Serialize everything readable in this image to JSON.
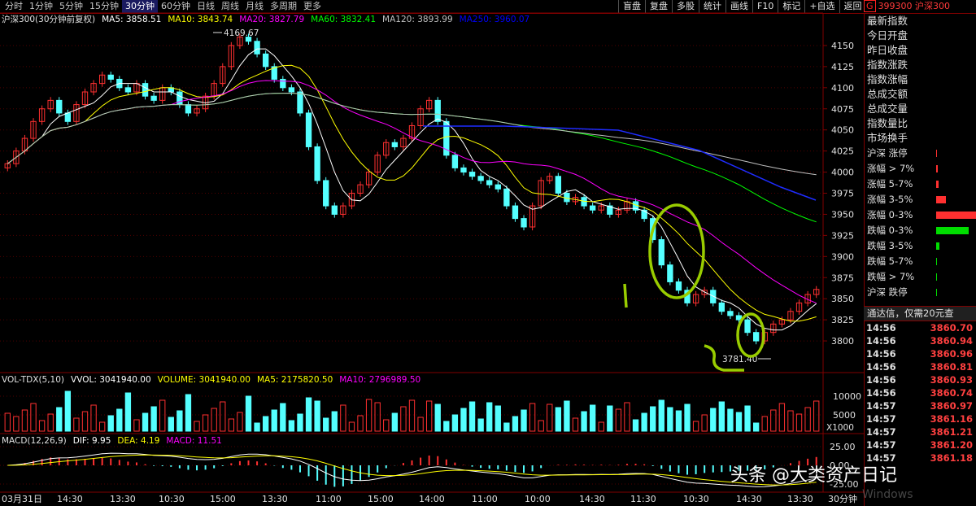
{
  "toolbar": {
    "periods": [
      "分时",
      "1分钟",
      "5分钟",
      "15分钟",
      "30分钟",
      "60分钟",
      "日线",
      "周线",
      "月线",
      "多周期",
      "更多"
    ],
    "active_period": "30分钟",
    "right_tools": [
      "盲盘",
      "复盘",
      "多股",
      "统计",
      "画线",
      "F10",
      "标记",
      "+自选",
      "返回"
    ],
    "code_badge": "G",
    "code": "399300",
    "name": "沪深300"
  },
  "main_header": {
    "title": "沪深300(30分钟前复权)",
    "ma": [
      {
        "label": "MA5: 3858.51",
        "color": "#ffffff"
      },
      {
        "label": "MA10: 3843.74",
        "color": "#ffff00"
      },
      {
        "label": "MA20: 3827.79",
        "color": "#ff00ff"
      },
      {
        "label": "MA60: 3832.41",
        "color": "#00ff00"
      },
      {
        "label": "MA120: 3893.99",
        "color": "#c0c0c0"
      },
      {
        "label": "MA250: 3960.07",
        "color": "#0000ff"
      }
    ]
  },
  "price_axis": [
    "4150",
    "4125",
    "4100",
    "4075",
    "4050",
    "4025",
    "4000",
    "3975",
    "3950",
    "3925",
    "3900",
    "3875",
    "3850",
    "3825",
    "3800"
  ],
  "price_annotations": {
    "high": "4169.67",
    "low": "3781.40"
  },
  "vol_header": {
    "title": "VOL-TDX(5,10)",
    "items": [
      {
        "label": "VVOL: 3041940.00",
        "color": "#ffffff"
      },
      {
        "label": "VOLUME: 3041940.00",
        "color": "#ffff00"
      },
      {
        "label": "MA5: 2175820.50",
        "color": "#ffff00"
      },
      {
        "label": "MA10: 2796989.50",
        "color": "#ff00ff"
      }
    ]
  },
  "vol_axis": [
    "10000",
    "5000"
  ],
  "vol_unit": "X1000",
  "macd_header": {
    "title": "MACD(12,26,9)",
    "items": [
      {
        "label": "DIF: 9.95",
        "color": "#ffffff"
      },
      {
        "label": "DEA: 4.19",
        "color": "#ffff00"
      },
      {
        "label": "MACD: 11.51",
        "color": "#ff00ff"
      }
    ]
  },
  "macd_axis": [
    "25.00",
    "0.00",
    "-25.00"
  ],
  "time_axis": [
    "03月31日",
    "14:30",
    "13:30",
    "10:30",
    "15:00",
    "13:30",
    "11:00",
    "15:00",
    "14:00",
    "11:00",
    "10:00",
    "14:30",
    "11:30",
    "10:30",
    "14:30",
    "13:30"
  ],
  "time_axis_period": "30分钟",
  "right_panel": {
    "fields": [
      "最新指数",
      "今日开盘",
      "昨日收盘",
      "指数涨跌",
      "指数涨幅",
      "总成交额",
      "总成交量",
      "指数量比",
      "市场换手"
    ],
    "breadth": [
      {
        "label": "沪深 涨停",
        "bar": 0,
        "color": "#ff3030"
      },
      {
        "label": "涨幅 > 7%",
        "bar": 2,
        "color": "#ff3030"
      },
      {
        "label": "涨幅 5-7%",
        "bar": 3,
        "color": "#ff3030"
      },
      {
        "label": "涨幅 3-5%",
        "bar": 12,
        "color": "#ff3030"
      },
      {
        "label": "涨幅 0-3%",
        "bar": 50,
        "color": "#ff3030"
      },
      {
        "label": "跌幅 0-3%",
        "bar": 40,
        "color": "#00dd00"
      },
      {
        "label": "跌幅 3-5%",
        "bar": 4,
        "color": "#00dd00"
      },
      {
        "label": "跌幅 5-7%",
        "bar": 1,
        "color": "#00dd00"
      },
      {
        "label": "跌幅 > 7%",
        "bar": 1,
        "color": "#00dd00"
      },
      {
        "label": "沪深 跌停",
        "bar": 1,
        "color": "#00dd00"
      }
    ],
    "ad_text": "通达信，仅需20元查",
    "ticks": [
      {
        "time": "14:56",
        "price": "3860.70"
      },
      {
        "time": "14:56",
        "price": "3860.94"
      },
      {
        "time": "14:56",
        "price": "3860.96"
      },
      {
        "time": "14:56",
        "price": "3860.81"
      },
      {
        "time": "14:56",
        "price": "3860.93"
      },
      {
        "time": "14:56",
        "price": "3860.74"
      },
      {
        "time": "14:57",
        "price": "3860.97"
      },
      {
        "time": "14:57",
        "price": "3861.16"
      },
      {
        "time": "14:57",
        "price": "3861.21"
      },
      {
        "time": "14:57",
        "price": "3861.20"
      },
      {
        "time": "14:57",
        "price": "3861.18"
      }
    ]
  },
  "watermark": "头条 @大类资产日记",
  "os_watermark": "Windows",
  "colors": {
    "up": "#ff3030",
    "down": "#54ffff",
    "border": "#800000",
    "grid": "#800000",
    "annotation": "#99cc00"
  },
  "chart_data": {
    "type": "candlestick",
    "title": "沪深300(30分钟前复权)",
    "ylim": [
      3775,
      4175
    ],
    "ohlc_close": [
      4010,
      4025,
      4040,
      4060,
      4075,
      4085,
      4070,
      4060,
      4080,
      4095,
      4105,
      4115,
      4110,
      4100,
      4095,
      4105,
      4090,
      4085,
      4100,
      4095,
      4080,
      4070,
      4075,
      4090,
      4105,
      4125,
      4150,
      4160,
      4155,
      4140,
      4125,
      4110,
      4100,
      4095,
      4070,
      4030,
      3990,
      3960,
      3950,
      3960,
      3975,
      3985,
      4000,
      4020,
      4035,
      4030,
      4040,
      4055,
      4075,
      4085,
      4060,
      4020,
      4005,
      4000,
      3995,
      3990,
      3985,
      3980,
      3960,
      3945,
      3935,
      3960,
      3990,
      3995,
      3975,
      3965,
      3970,
      3960,
      3955,
      3960,
      3950,
      3955,
      3965,
      3955,
      3945,
      3920,
      3890,
      3870,
      3860,
      3845,
      3855,
      3860,
      3845,
      3835,
      3830,
      3825,
      3810,
      3800,
      3810,
      3820,
      3825,
      3835,
      3845,
      3855,
      3861
    ]
  }
}
